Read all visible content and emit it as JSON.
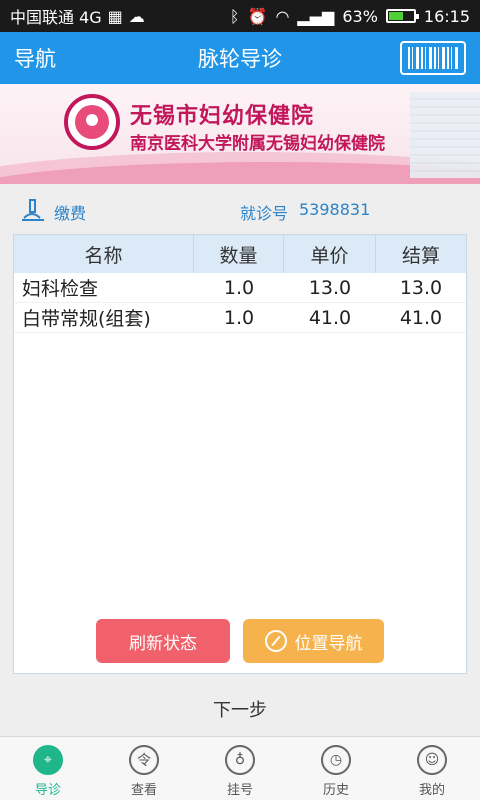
{
  "status_bar": {
    "carrier": "中国联通 4G",
    "battery": "63%",
    "battery_level": 0.63,
    "time": "16:15"
  },
  "header": {
    "left_label": "导航",
    "title": "脉轮导诊"
  },
  "banner": {
    "hospital_name": "无锡市妇幼保健院",
    "hospital_subtitle": "南京医科大学附属无锡妇幼保健院"
  },
  "info": {
    "pay_label": "缴费",
    "visit_label": "就诊号",
    "visit_number": "5398831"
  },
  "table": {
    "headers": [
      "名称",
      "数量",
      "单价",
      "结算"
    ],
    "rows": [
      [
        "妇科检查",
        "1.0",
        "13.0",
        "13.0"
      ],
      [
        "白带常规(组套)",
        "1.0",
        "41.0",
        "41.0"
      ]
    ]
  },
  "actions": {
    "refresh": "刷新状态",
    "locate": "位置导航",
    "next": "下一步"
  },
  "tabs": [
    {
      "label": "导诊",
      "icon": "location-icon",
      "active": true
    },
    {
      "label": "查看",
      "icon": "view-icon",
      "active": false
    },
    {
      "label": "挂号",
      "icon": "stethoscope-icon",
      "active": false
    },
    {
      "label": "历史",
      "icon": "clock-icon",
      "active": false
    },
    {
      "label": "我的",
      "icon": "user-icon",
      "active": false
    }
  ],
  "colors": {
    "primary": "#2196e8",
    "refresh": "#f0616b",
    "locate": "#f6b24d",
    "active_tab": "#1fb68c",
    "brand": "#c2185b"
  }
}
